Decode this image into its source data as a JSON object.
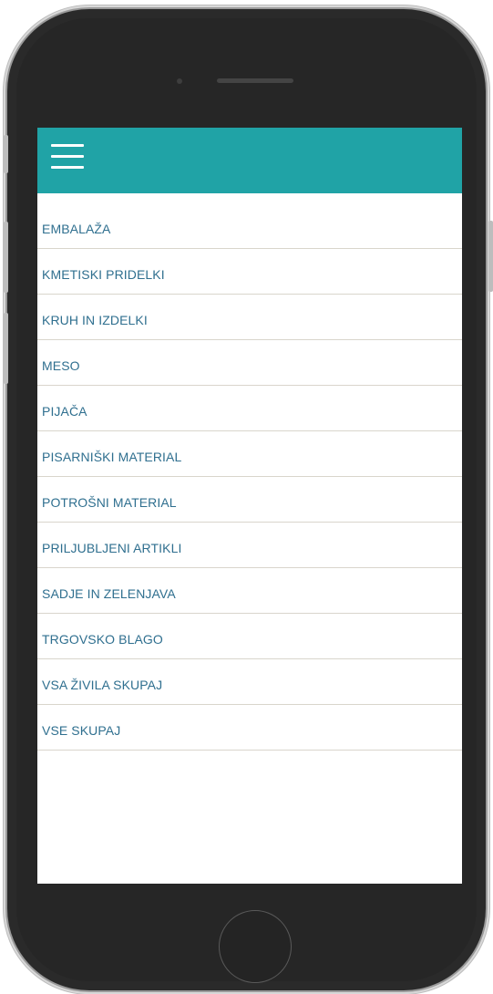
{
  "colors": {
    "header": "#20a3a6",
    "menu_text": "#2f6f8f",
    "divider": "#d9d5cc",
    "phone_body": "#262626"
  },
  "header": {
    "menu_icon": "hamburger-menu-icon"
  },
  "menu": {
    "items": [
      {
        "label": "EMBALAŽA"
      },
      {
        "label": "KMETISKI PRIDELKI"
      },
      {
        "label": "KRUH IN IZDELKI"
      },
      {
        "label": "MESO"
      },
      {
        "label": "PIJAČA"
      },
      {
        "label": "PISARNIŠKI MATERIAL"
      },
      {
        "label": "POTROŠNI MATERIAL"
      },
      {
        "label": "PRILJUBLJENI ARTIKLI"
      },
      {
        "label": "SADJE IN ZELENJAVA"
      },
      {
        "label": "TRGOVSKO BLAGO"
      },
      {
        "label": "VSA ŽIVILA SKUPAJ"
      },
      {
        "label": "VSE SKUPAJ"
      }
    ]
  }
}
